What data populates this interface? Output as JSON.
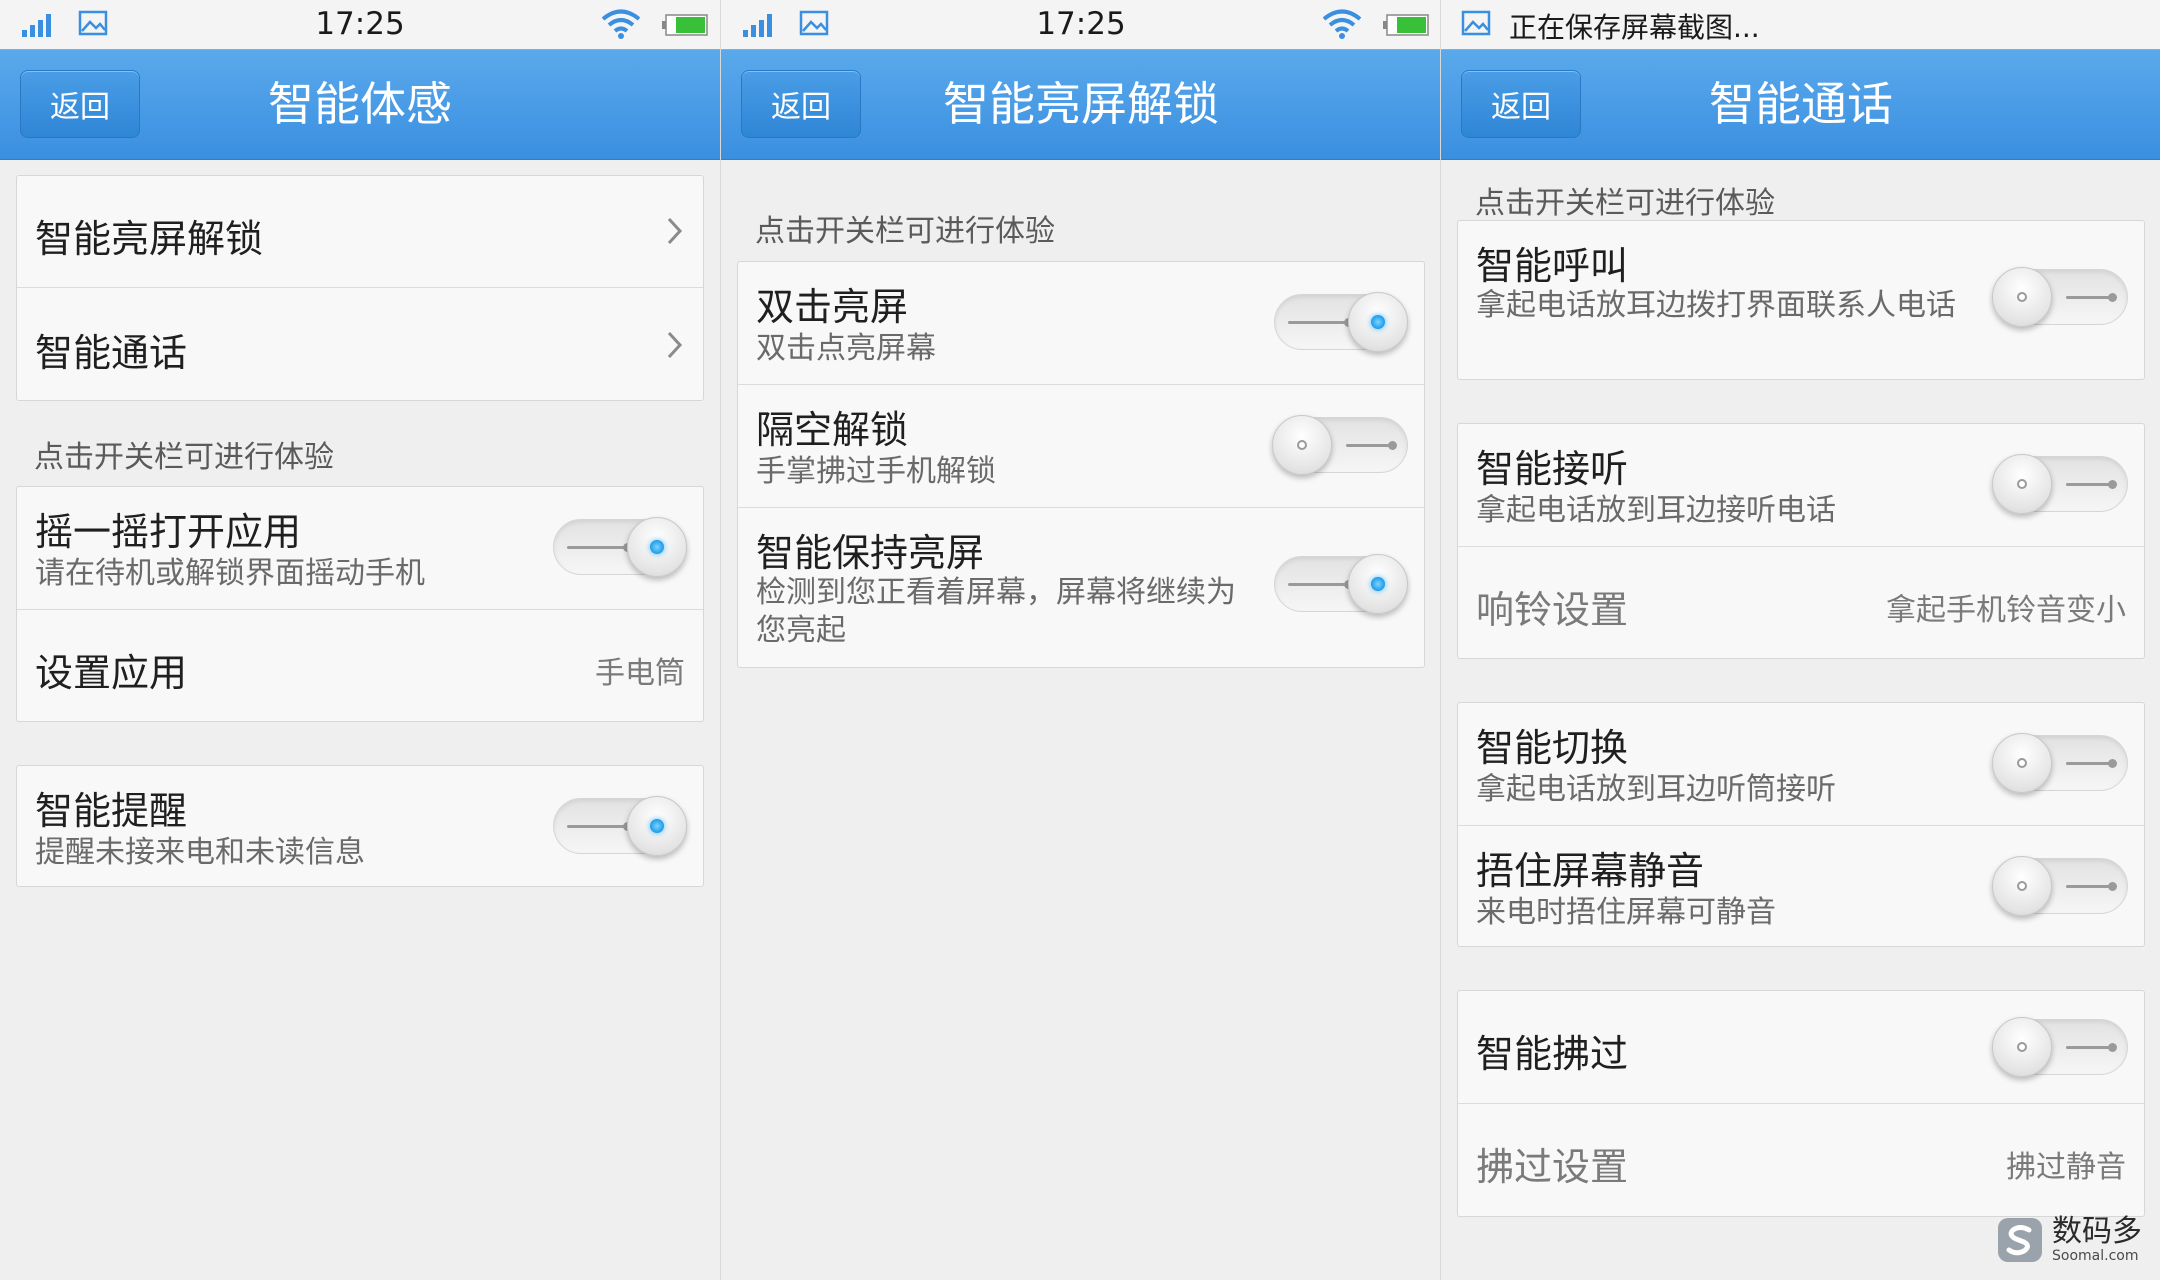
{
  "colors": {
    "accent": "#3a8fe0",
    "toggle_on_dot": "#1c9ae8"
  },
  "status": {
    "time": "17:25",
    "saving": "正在保存屏幕截图..."
  },
  "back_label": "返回",
  "screen1": {
    "title": "智能体感",
    "nav": [
      {
        "label": "智能亮屏解锁"
      },
      {
        "label": "智能通话"
      }
    ],
    "hint": "点击开关栏可进行体验",
    "shake": {
      "title": "摇一摇打开应用",
      "subtitle": "请在待机或解锁界面摇动手机",
      "enabled": true
    },
    "set_app": {
      "title": "设置应用",
      "value": "手电筒"
    },
    "reminder": {
      "title": "智能提醒",
      "subtitle": "提醒未接来电和未读信息",
      "enabled": true
    }
  },
  "screen2": {
    "title": "智能亮屏解锁",
    "hint": "点击开关栏可进行体验",
    "items": [
      {
        "title": "双击亮屏",
        "subtitle": "双击点亮屏幕",
        "enabled": true
      },
      {
        "title": "隔空解锁",
        "subtitle": "手掌拂过手机解锁",
        "enabled": false
      },
      {
        "title": "智能保持亮屏",
        "subtitle": "检测到您正看着屏幕，屏幕将继续为您亮起",
        "enabled": true
      }
    ]
  },
  "screen3": {
    "title": "智能通话",
    "hint": "点击开关栏可进行体验",
    "call": {
      "title": "智能呼叫",
      "subtitle": "拿起电话放耳边拨打界面联系人电话",
      "enabled": false
    },
    "answer": {
      "title": "智能接听",
      "subtitle": "拿起电话放到耳边接听电话",
      "enabled": false
    },
    "ringtone": {
      "title": "响铃设置",
      "value": "拿起手机铃音变小"
    },
    "switch": {
      "title": "智能切换",
      "subtitle": "拿起电话放到耳边听筒接听",
      "enabled": false
    },
    "mute": {
      "title": "捂住屏幕静音",
      "subtitle": "来电时捂住屏幕可静音",
      "enabled": false
    },
    "swipe": {
      "title": "智能拂过",
      "enabled": false
    },
    "swipe_setting": {
      "title": "拂过设置",
      "value": "拂过静音"
    }
  },
  "watermark": {
    "cn": "数码多",
    "en": "Soomal.com"
  }
}
